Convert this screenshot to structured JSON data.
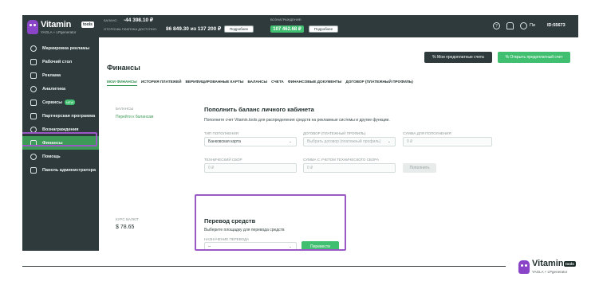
{
  "brand": {
    "name": "Vitamin",
    "badge": "tools",
    "subtitle": "YAGLA + LPgenerator",
    "accent": "#8a44c8"
  },
  "colors": {
    "sidebar": "#2e3a3c",
    "green": "#3fbf6f",
    "active_green": "#3d9a57",
    "panel_bg": "#f0f7f2",
    "highlight": "#9b59c6"
  },
  "sidebar": {
    "items": [
      {
        "label": "Маркировка рекламы",
        "icon": "check-circle-icon"
      },
      {
        "label": "Рабочий стол",
        "icon": "desktop-icon"
      },
      {
        "label": "Реклама",
        "icon": "megaphone-icon"
      },
      {
        "label": "Аналитика",
        "icon": "chart-icon"
      },
      {
        "label": "Сервисы",
        "icon": "briefcase-icon",
        "badge": "NEW"
      },
      {
        "label": "Партнерская программа",
        "icon": "handshake-icon"
      },
      {
        "label": "Вознаграждения",
        "icon": "gift-icon"
      },
      {
        "label": "Финансы",
        "icon": "wallet-icon",
        "active": true
      },
      {
        "label": "Помощь",
        "icon": "help-icon"
      },
      {
        "label": "Панель администратора",
        "icon": "admin-icon"
      }
    ]
  },
  "topbar": {
    "balance_label": "БАЛАНС:",
    "balance_value": "-44 398.10 ₽",
    "deferred_label": "ОТСРОЧКА ПЛАТЕЖА ДОСТУПНО:",
    "deferred_value": "86 849.30 из 137 200 ₽",
    "details_label": "Подробнее",
    "reward_label": "ВОЗНАГРАЖДЕНИЕ:",
    "reward_value": "107 462.68 ₽",
    "details_label_2": "Подробнее",
    "user_short": "Пи",
    "user_id": "ID:55673"
  },
  "main": {
    "btn_my_accounts": "% Мои предоплатные счета",
    "btn_open_account": "% Открыть предоплатный счет",
    "title": "Финансы",
    "tabs": [
      {
        "label": "МОИ ФИНАНСЫ",
        "active": true
      },
      {
        "label": "ИСТОРИЯ ПЛАТЕЖЕЙ"
      },
      {
        "label": "ВЕРИФИЦИРОВАННЫЕ КАРТЫ"
      },
      {
        "label": "БАЛАНСЫ"
      },
      {
        "label": "СЧЕТА"
      },
      {
        "label": "ФИНАНСОВЫЕ ДОКУМЕНТЫ"
      },
      {
        "label": "ДОГОВОР (ПЛАТЕЖНЫЙ ПРОФИЛЬ)"
      }
    ]
  },
  "topup": {
    "side_label": "БАЛАНСЫ",
    "side_link": "Перейти к балансам",
    "title": "Пополнить баланс личного кабинета",
    "desc": "Пополните счет Vitamin.tools для распределения средств на рекламные системы и другие функции.",
    "type_label": "ТИП ПОПОЛНЕНИЯ",
    "type_value": "Банковская карта",
    "contract_label": "ДОГОВОР (ПЛАТЕЖНЫЙ ПРОФИЛЬ)",
    "contract_placeholder": "Выбрать договор (платежный профиль)",
    "amount_label": "СУММА ДЛЯ ПОПОЛНЕНИЯ",
    "amount_placeholder": "0 ₽",
    "fee_label": "ТЕХНИЧЕСКИЙ СБОР",
    "fee_value": "0 ₽",
    "total_label": "СУММА С УЧЕТОМ ТЕХНИЧЕСКОГО СБОРА",
    "total_value": "0 ₽",
    "submit": "Пополнить"
  },
  "transfer": {
    "rate_label": "КУРС ВАЛЮТ",
    "rate_value": "$  78.65",
    "title": "Перевод средств",
    "desc": "Выберите площадку для перевода средств",
    "dest_label": "НАЗНАЧЕНИЕ ПЕРЕВОДА",
    "dest_value": "--",
    "submit": "Перевести"
  },
  "footer": {
    "name": "Vitamin",
    "badge": "tools",
    "subtitle": "YAGLA + LPgenerator"
  }
}
